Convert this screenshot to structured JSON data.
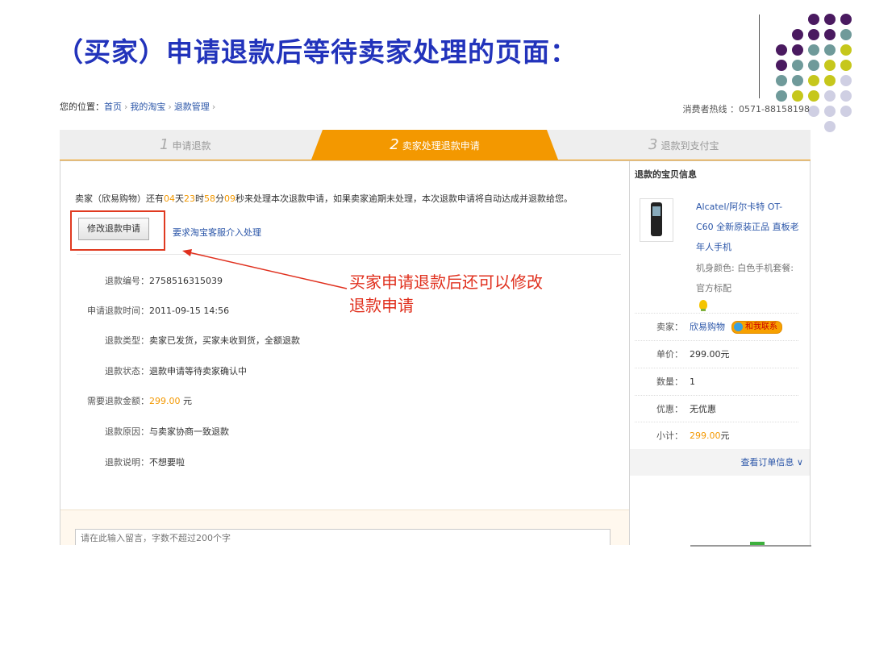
{
  "slide": {
    "title": "（买家）申请退款后等待卖家处理的页面：",
    "annotation_line1": "买家申请退款后还可以修改",
    "annotation_line2": "退款申请"
  },
  "breadcrumb": {
    "prefix": "您的位置：",
    "items": [
      "首页",
      "我的淘宝",
      "退款管理"
    ],
    "separator": "›"
  },
  "hotline": "消费者热线 ：0571-88158198",
  "steps": [
    {
      "num": "1",
      "label": "申请退款",
      "active": false
    },
    {
      "num": "2",
      "label": "卖家处理退款申请",
      "active": true
    },
    {
      "num": "3",
      "label": "退款到支付宝",
      "active": false
    }
  ],
  "notice": {
    "pre": "卖家（欣易购物）还有",
    "days": "04",
    "d_unit": "天",
    "hours": "23",
    "h_unit": "时",
    "minutes": "58",
    "m_unit": "分",
    "seconds": "09",
    "post": "秒来处理本次退款申请，如果卖家逾期未处理，本次退款申请将自动达成并退款给您。"
  },
  "actions": {
    "modify_button": "修改退款申请",
    "customer_service_link": "要求淘宝客服介入处理"
  },
  "refund_details": [
    {
      "label": "退款编号：",
      "value": "2758516315039"
    },
    {
      "label": "申请退款时间：",
      "value": "2011-09-15 14:56"
    },
    {
      "label": "退款类型：",
      "value": "卖家已发货，买家未收到货，全额退款"
    },
    {
      "label": "退款状态：",
      "value": "退款申请等待卖家确认中"
    },
    {
      "label": "需要退款金额：",
      "value": "299.00",
      "unit": " 元"
    },
    {
      "label": "退款原因：",
      "value": "与卖家协商一致退款"
    },
    {
      "label": "退款说明：",
      "value": "不想要啦"
    }
  ],
  "message_box": {
    "placeholder": "请在此输入留言，字数不超过200个字"
  },
  "sidebar": {
    "title": "退款的宝贝信息",
    "product_title": "Alcatel/阿尔卡特 OT-C60 全新原装正品 直板老年人手机",
    "product_color": "机身颜色: 白色手机套餐: 官方标配",
    "seller_label": "卖家：",
    "seller_name": "欣易购物",
    "contact_label": "和我联系",
    "unit_price_label": "单价：",
    "unit_price": "299.00元",
    "quantity_label": "数量：",
    "quantity": "1",
    "discount_label": "优惠：",
    "discount": "无优惠",
    "subtotal_label": "小计：",
    "subtotal_amount": "299.00",
    "subtotal_unit": "元",
    "view_order": "查看订单信息 ∨"
  },
  "colors": {
    "title_blue": "#2233bb",
    "accent_orange": "#f39800",
    "link_blue": "#2a55a8",
    "annotation_red": "#e0301e",
    "dot_purple": "#4a1a60",
    "dot_teal": "#6f9a9a",
    "dot_lime": "#c6c71c",
    "dot_lavender": "#cfcfe3"
  }
}
